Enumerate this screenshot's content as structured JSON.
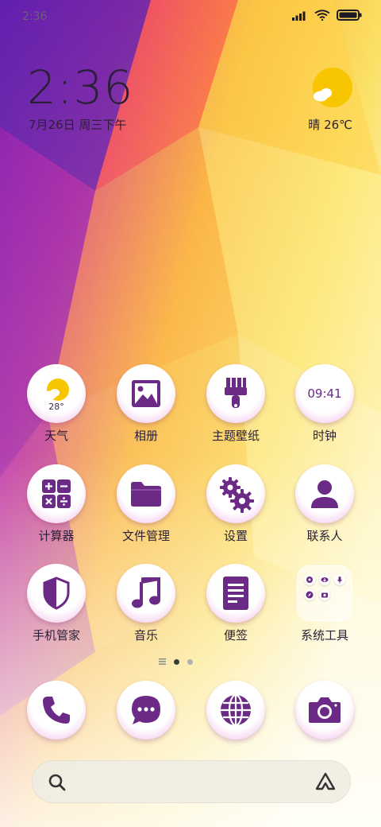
{
  "status_bar": {
    "time": "2:36",
    "icons": [
      "signal-icon",
      "wifi-icon",
      "battery-icon"
    ]
  },
  "lockwidget": {
    "clock": "2:36",
    "date": "7月26日 周三下午",
    "weather": "晴 26℃",
    "weather_icon": "sun-cloud-icon"
  },
  "apps": [
    {
      "label": "天气",
      "icon": "weather-icon",
      "temp": "28°"
    },
    {
      "label": "相册",
      "icon": "gallery-icon"
    },
    {
      "label": "主题壁纸",
      "icon": "brush-icon"
    },
    {
      "label": "时钟",
      "icon": "clock-icon",
      "time": "09:41"
    },
    {
      "label": "计算器",
      "icon": "calculator-icon"
    },
    {
      "label": "文件管理",
      "icon": "folder-icon"
    },
    {
      "label": "设置",
      "icon": "gear-icon"
    },
    {
      "label": "联系人",
      "icon": "person-icon"
    },
    {
      "label": "手机管家",
      "icon": "shield-icon"
    },
    {
      "label": "音乐",
      "icon": "music-icon"
    },
    {
      "label": "便签",
      "icon": "notes-icon"
    },
    {
      "label": "系统工具",
      "icon": "folder-system-tools-icon"
    }
  ],
  "dock": [
    {
      "icon": "phone-icon"
    },
    {
      "icon": "message-icon"
    },
    {
      "icon": "browser-icon"
    },
    {
      "icon": "camera-icon"
    }
  ],
  "page_indicator": {
    "pages": 2,
    "active": 1
  },
  "search": {
    "search_icon": "search-icon",
    "assistant_icon": "assistant-icon"
  },
  "colors": {
    "icon_purple": "#6a2a86",
    "accent_yellow": "#f7c600"
  }
}
